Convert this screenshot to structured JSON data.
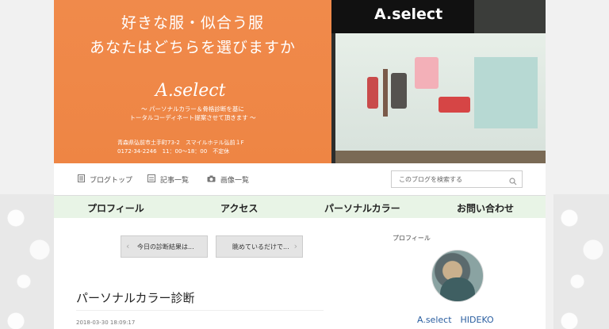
{
  "header": {
    "tagline_line1": "好きな服・似合う服",
    "tagline_line2": "あなたはどちらを選びますか",
    "logo": "A.select",
    "description_line1": "〜 パーソナルカラー＆骨格診断を基に",
    "description_line2": "トータルコーディネート提案させて頂きます 〜",
    "address_line1": "青森県弘前市土手町73-2　スマイルホテル弘前１F",
    "address_line2": "0172-34-2246　11：00〜18：00　不定休",
    "store_sign": "A.select",
    "accent_color": "#ef874a"
  },
  "nav": {
    "links": [
      {
        "label": "ブログトップ",
        "icon": "document-icon"
      },
      {
        "label": "記事一覧",
        "icon": "list-icon"
      },
      {
        "label": "画像一覧",
        "icon": "camera-icon"
      }
    ],
    "search_placeholder": "このブログを検索する"
  },
  "menu": {
    "items": [
      "プロフィール",
      "アクセス",
      "パーソナルカラー",
      "お問い合わせ"
    ],
    "background": "#e8f4e6"
  },
  "post_nav": {
    "prev_label": "今日の診断結果は...",
    "next_label": "眺めているだけで..."
  },
  "article": {
    "title": "パーソナルカラー診断",
    "date": "2018-03-30 18:09:17"
  },
  "sidebar": {
    "title": "プロフィール",
    "name": "A.select　HIDEKO"
  }
}
